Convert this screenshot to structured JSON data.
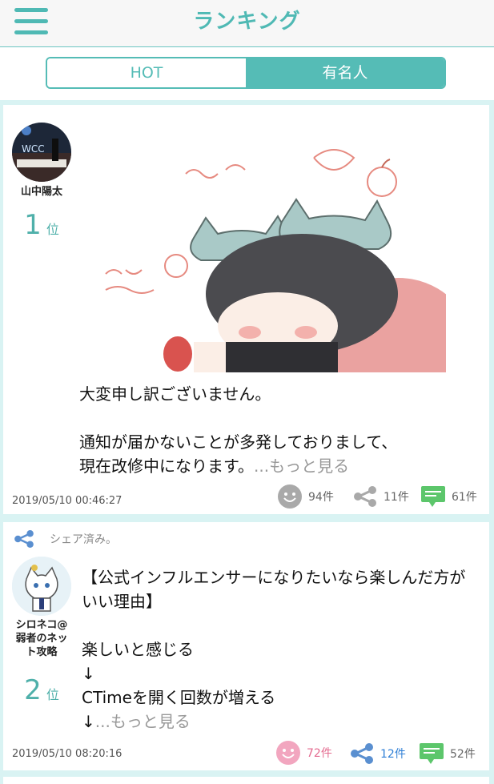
{
  "header": {
    "title": "ランキング"
  },
  "tabs": [
    {
      "label": "HOT"
    },
    {
      "label": "有名人"
    }
  ],
  "posts": [
    {
      "user": "山中陽太",
      "rank": "1",
      "rank_unit": "位",
      "text": "大変申し訳ございません。\n\n通知が届かないことが多発しておりまして、\n現在改修中になります。",
      "more": "...もっと見る",
      "date": "2019/05/10 00:46:27",
      "likes": "94件",
      "shares": "11件",
      "comments": "61件"
    },
    {
      "shared_label": "シェア済み。",
      "user": "シロネコ@\n弱者のネッ\nト攻略",
      "rank": "2",
      "rank_unit": "位",
      "text": "【公式インフルエンサーになりたいなら楽しんだ方がいい理由】\n\n楽しいと感じる\n↓\nCTimeを開く回数が増える\n↓",
      "more": "...もっと見る",
      "date": "2019/05/10 08:20:16",
      "likes": "72件",
      "shares": "12件",
      "comments": "52件"
    }
  ],
  "colors": {
    "accent": "#4fb9b4",
    "like_active": "#e46a8f",
    "share_active": "#2f7fd6",
    "comment": "#5cc66b"
  }
}
